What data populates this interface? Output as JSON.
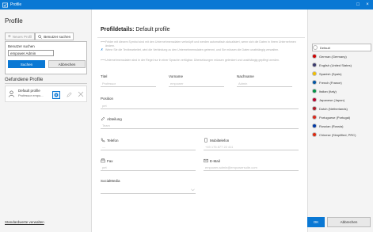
{
  "window": {
    "title": "Profile",
    "controls": {
      "maximize": "□",
      "close": "×"
    }
  },
  "sidebar": {
    "heading": "Profile",
    "tabs": [
      {
        "label": "Neues Profil"
      },
      {
        "label": "Benutzer suchen"
      }
    ],
    "search": {
      "label": "Benutzer suchen",
      "value": "empower Admin",
      "search_button": "Suchen",
      "cancel_button": "Abbrechen"
    },
    "found_heading": "Gefundene Profile",
    "results": [
      {
        "name": "Default profile",
        "sub": "Professor empo..."
      }
    ],
    "defaults_link": "Standardwerte verwalten"
  },
  "main": {
    "heading_prefix": "Profildetails:",
    "heading_name": "Default profile",
    "info": [
      "Felder mit diesem Symbol sind mit den Unternehmensdaten verknüpft und werden automatisch aktualisiert, wenn sich die Daten in Ihrem Unternehmen ändern.",
      "Wenn Sie die Textbearbeitet, wird die Verbindung zu den Unternehmensdaten getrennt, und Sie müssen die Daten unabhängig verwalten.",
      "Unternehmensdaten sind in der Regel nur in einer Sprache verfügbar. Übersetzungen müssen gelenkert und unabhängig gepflegt werden."
    ],
    "fields": {
      "title": {
        "label": "Titel",
        "value": "Professor"
      },
      "first_name": {
        "label": "Vorname",
        "value": "empower"
      },
      "last_name": {
        "label": "Nachname",
        "value": "Admin"
      },
      "position": {
        "label": "Position",
        "value": "pet"
      },
      "department": {
        "label": "Abteilung",
        "value": "Team"
      },
      "phone": {
        "label": "Telefon",
        "value": "—"
      },
      "mobile": {
        "label": "Mobiltelefon",
        "value": "+49 176 877 22 411"
      },
      "fax": {
        "label": "Fax",
        "value": "pet"
      },
      "email": {
        "label": "E-Mail",
        "value": "empower.admin@empowersuite.com"
      },
      "social": {
        "label": "SocialMedia",
        "value": ""
      }
    }
  },
  "languages": [
    {
      "label": "Default",
      "selected": true,
      "color": "#ffffff"
    },
    {
      "label": "German (Germany)",
      "selected": false,
      "color": "#d00000"
    },
    {
      "label": "English (United States)",
      "selected": false,
      "color": "#3c3b6e"
    },
    {
      "label": "Spanish (Spain)",
      "selected": false,
      "color": "#f1bf00"
    },
    {
      "label": "French (France)",
      "selected": false,
      "color": "#0055a4"
    },
    {
      "label": "Italian (Italy)",
      "selected": false,
      "color": "#009246"
    },
    {
      "label": "Japanese (Japan)",
      "selected": false,
      "color": "#bc002d"
    },
    {
      "label": "Dutch (Netherlands)",
      "selected": false,
      "color": "#ae1c28"
    },
    {
      "label": "Portuguese (Portugal)",
      "selected": false,
      "color": "#da291c"
    },
    {
      "label": "Russian (Russia)",
      "selected": false,
      "color": "#0039a6"
    },
    {
      "label": "Chinese (Simplified, PRC)",
      "selected": false,
      "color": "#de2910"
    }
  ],
  "footer": {
    "ok": "OK",
    "cancel": "Abbrechen"
  },
  "colors": {
    "accent": "#0a78d4"
  }
}
